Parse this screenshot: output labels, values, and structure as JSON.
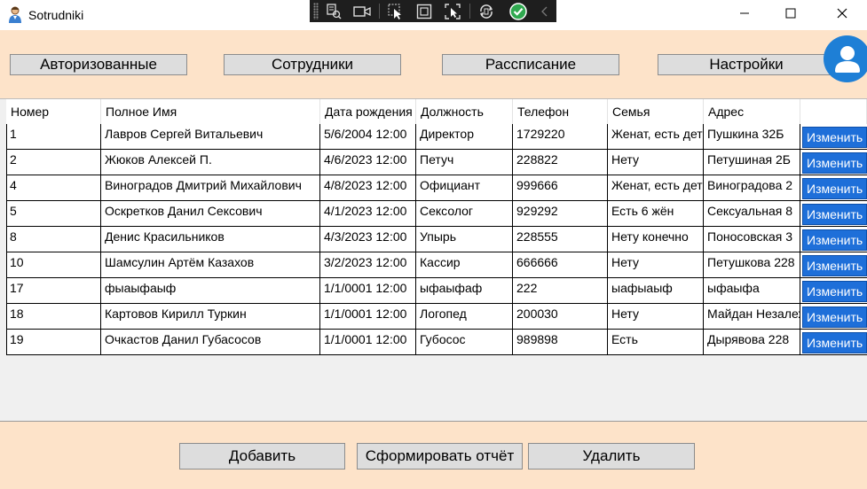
{
  "window": {
    "title": "Sotrudniki",
    "icons": {
      "app": "user-app-icon",
      "minimize": "minimize-icon",
      "maximize": "maximize-icon",
      "close": "close-icon"
    }
  },
  "debug_toolbar": {
    "icons": [
      "grip-icon",
      "live-visual-tree-icon",
      "record-icon",
      "select-element-icon",
      "display-layout-adorners-icon",
      "track-focused-element-icon",
      "hot-reload-icon",
      "checkmark-icon",
      "collapse-chevron-icon"
    ]
  },
  "nav": {
    "authorized": "Авторизованные",
    "employees": "Сотрудники",
    "schedule": "Рассписание",
    "settings": "Настройки",
    "avatar_icon": "user-avatar-icon"
  },
  "table": {
    "columns": [
      "Номер",
      "Полное Имя",
      "Дата рождения",
      "Должность",
      "Телефон",
      "Семья",
      "Адрес",
      ""
    ],
    "rows": [
      [
        "1",
        "Лавров Сергей Витальевич",
        "5/6/2004 12:00",
        "Директор",
        "1729220",
        "Женат, есть дети",
        "Пушкина 32Б",
        "Изменить"
      ],
      [
        "2",
        "Жюков Алексей П.",
        "4/6/2023 12:00",
        "Петуч",
        "228822",
        "Нету",
        "Петушиная 2Б",
        "Изменить"
      ],
      [
        "4",
        "Виноградов Дмитрий Михайлович",
        "4/8/2023 12:00",
        "Официант",
        "999666",
        "Женат, есть дети",
        "Виноградова 2",
        "Изменить"
      ],
      [
        "5",
        "Оскретков Данил Сексович",
        "4/1/2023 12:00",
        "Сексолог",
        "929292",
        "Есть 6 жён",
        "Сексуальная 8",
        "Изменить"
      ],
      [
        "8",
        "Денис Красильников",
        "4/3/2023 12:00",
        "Упырь",
        "228555",
        "Нету конечно",
        "Поносовская 3",
        "Изменить"
      ],
      [
        "10",
        "Шамсулин Артём Казахов",
        "3/2/2023 12:00",
        "Кассир",
        "666666",
        "Нету",
        "Петушкова 228",
        "Изменить"
      ],
      [
        "17",
        "фыаыфаыф",
        "1/1/0001 12:00",
        "ыфаыфаф",
        "222",
        "ыафыаыф",
        "ыфаыфа",
        "Изменить"
      ],
      [
        "18",
        "Картовов Кирилл Туркин",
        "1/1/0001 12:00",
        "Логопед",
        "200030",
        "Нету",
        "Майдан Незалежности",
        "Изменить"
      ],
      [
        "19",
        "Очкастов Данил Губасосов",
        "1/1/0001 12:00",
        "Губосос",
        "989898",
        "Есть",
        "Дырявова 228",
        "Изменить"
      ]
    ]
  },
  "footer": {
    "add": "Добавить",
    "report": "Сформировать отчёт",
    "delete": "Удалить"
  },
  "colors": {
    "window_bg": "#fde3c9",
    "edit_button": "#1e6fd9",
    "toolbar_bg": "#1e1e1e",
    "avatar": "#1e7fd6"
  }
}
